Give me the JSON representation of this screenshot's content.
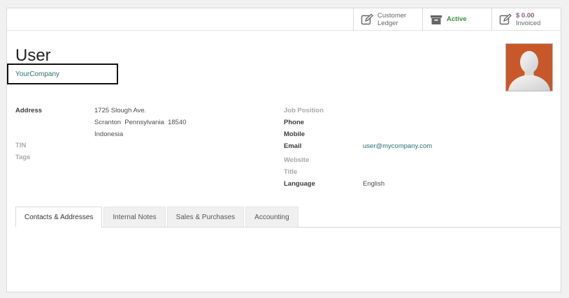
{
  "button_box": {
    "ledger": {
      "line1": "Customer",
      "line2": "Ledger"
    },
    "active": {
      "label": "Active"
    },
    "invoiced": {
      "value": "$ 0.00",
      "label": "Invoiced"
    }
  },
  "partner": {
    "name": "User",
    "company": "YourCompany"
  },
  "left_fields": {
    "address_label": "Address",
    "address_street": "1725 Slough Ave.",
    "address_city_line": "Scranton  Pennsylvania  18540",
    "address_country": "Indonesia",
    "tin_label": "TIN",
    "tags_label": "Tags"
  },
  "right_fields": {
    "job_position_label": "Job Position",
    "phone_label": "Phone",
    "mobile_label": "Mobile",
    "email_label": "Email",
    "email_value": "user@mycompany.com",
    "website_label": "Website",
    "title_label": "Title",
    "language_label": "Language",
    "language_value": "English"
  },
  "tabs": [
    {
      "label": "Contacts & Addresses",
      "active": true
    },
    {
      "label": "Internal Notes",
      "active": false
    },
    {
      "label": "Sales & Purchases",
      "active": false
    },
    {
      "label": "Accounting",
      "active": false
    }
  ],
  "colors": {
    "link": "#2a6f74",
    "active_green": "#3f8b3f",
    "invoiced_purple": "#875a7b",
    "avatar_bg": "#c8582a"
  }
}
